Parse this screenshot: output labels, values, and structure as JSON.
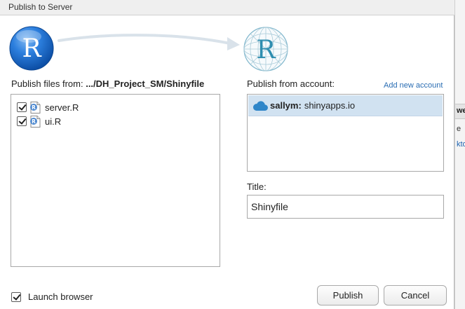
{
  "window": {
    "title": "Publish to Server"
  },
  "background": {
    "header_text": "we",
    "row1_text": "e",
    "row2_text": "kto"
  },
  "header": {
    "left_logo": "r-logo-icon",
    "right_logo": "r-globe-logo-icon",
    "arrow": "arrow-right-icon",
    "logo_letter": "R"
  },
  "files": {
    "label_prefix": "Publish files from: ",
    "path": ".../DH_Project_SM/Shinyfile",
    "items": [
      {
        "name": "server.R",
        "checked": true,
        "icon": "r-file-icon"
      },
      {
        "name": "ui.R",
        "checked": true,
        "icon": "r-file-icon"
      }
    ]
  },
  "account": {
    "label": "Publish from account:",
    "add_link": "Add new account",
    "items": [
      {
        "user": "sallym:",
        "server": "shinyapps.io",
        "icon": "cloud-icon",
        "selected": true
      }
    ]
  },
  "app_title": {
    "label": "Title:",
    "value": "Shinyfile"
  },
  "footer": {
    "launch_browser_label": "Launch browser",
    "launch_browser_checked": true,
    "publish_label": "Publish",
    "cancel_label": "Cancel"
  },
  "colors": {
    "r_blue": "#1a6fd0",
    "globe_teal": "#2f8eb0",
    "selection": "#d1e2f1",
    "link": "#2a6db3",
    "cloud": "#2f86c9"
  }
}
